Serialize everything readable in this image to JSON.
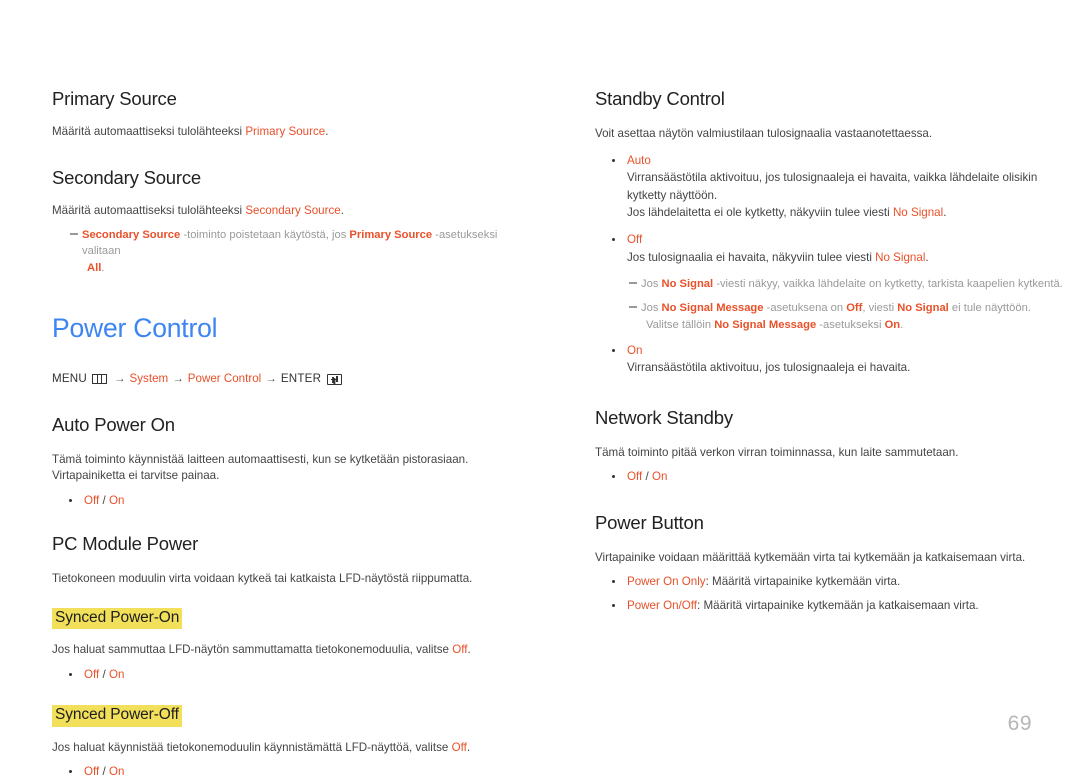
{
  "page": {
    "number": "69",
    "accent_orange": "#e8512a",
    "accent_blue": "#3d85f2",
    "highlight_yellow": "#f2e05a",
    "body_gray": "#444444",
    "note_gray": "#9a9a9a"
  },
  "left": {
    "primary_source": {
      "heading": "Primary Source",
      "body_pre": "Määritä automaattiseksi tulolähteeksi ",
      "body_key": "Primary Source",
      "body_post": "."
    },
    "secondary_source": {
      "heading": "Secondary Source",
      "body_pre": "Määritä automaattiseksi tulolähteeksi ",
      "body_key": "Secondary Source",
      "body_post": ".",
      "note": {
        "key1": "Secondary Source",
        "mid1": " -toiminto poistetaan käytöstä, jos ",
        "key2": "Primary Source",
        "mid2": " -asetukseksi valitaan",
        "key3": "All",
        "end": "."
      }
    },
    "chapter": {
      "title": "Power Control",
      "menu_label": "MENU",
      "menu_icon": "menu-grid-icon",
      "path1": "System",
      "path2": "Power Control",
      "enter_label": "ENTER",
      "enter_icon": "enter-key-icon",
      "arrow": "→"
    },
    "auto_power_on": {
      "heading": "Auto Power On",
      "body_line1": "Tämä toiminto käynnistää laitteen automaattisesti, kun se kytketään pistorasiaan.",
      "body_line2": "Virtapainiketta ei tarvitse painaa.",
      "option_off": "Off",
      "option_sep": " / ",
      "option_on": "On"
    },
    "pc_module_power": {
      "heading": "PC Module Power",
      "body": "Tietokoneen moduulin virta voidaan kytkeä tai katkaista LFD-näytöstä riippumatta.",
      "synced_on": {
        "heading": "Synced Power-On",
        "body_pre": "Jos haluat sammuttaa LFD-näytön sammuttamatta tietokonemoduulia, valitse ",
        "body_key": "Off",
        "body_post": ".",
        "option_off": "Off",
        "option_sep": " / ",
        "option_on": "On"
      },
      "synced_off": {
        "heading": "Synced Power-Off",
        "body_pre": "Jos haluat käynnistää tietokonemoduulin käynnistämättä LFD-näyttöä, valitse ",
        "body_key": "Off",
        "body_post": ".",
        "option_off": "Off",
        "option_sep": " / ",
        "option_on": "On"
      }
    }
  },
  "right": {
    "standby_control": {
      "heading": "Standby Control",
      "body": "Voit asettaa näytön valmiustilaan tulosignaalia vastaanotettaessa.",
      "auto": {
        "label": "Auto",
        "line1": "Virransäästötila aktivoituu, jos tulosignaaleja ei havaita, vaikka lähdelaite olisikin",
        "line1b": "kytketty näyttöön.",
        "line2_pre": "Jos lähdelaitetta ei ole kytketty, näkyviin tulee viesti ",
        "line2_key": "No Signal",
        "line2_post": "."
      },
      "off": {
        "label": "Off",
        "line_pre": "Jos tulosignaalia ei havaita, näkyviin tulee viesti ",
        "line_key": "No Signal",
        "line_post": "."
      },
      "note1": {
        "pre": "Jos ",
        "key1": "No Signal",
        "mid": " -viesti näkyy, vaikka lähdelaite on kytketty, tarkista kaapelien kytkentä."
      },
      "note2": {
        "pre": "Jos ",
        "key1": "No Signal Message",
        "mid1": " -asetuksena on ",
        "key2": "Off",
        "mid2": ", viesti ",
        "key3": "No Signal",
        "mid3": " ei tule näyttöön.",
        "cont_pre": "Valitse tällöin ",
        "cont_key1": "No Signal Message",
        "cont_mid": " -asetukseksi ",
        "cont_key2": "On",
        "cont_end": "."
      },
      "on": {
        "label": "On",
        "line": "Virransäästötila aktivoituu, jos tulosignaaleja ei havaita."
      }
    },
    "network_standby": {
      "heading": "Network Standby",
      "body": "Tämä toiminto pitää verkon virran toiminnassa, kun laite sammutetaan.",
      "option_off": "Off",
      "option_sep": " / ",
      "option_on": "On"
    },
    "power_button": {
      "heading": "Power Button",
      "body": "Virtapainike voidaan määrittää kytkemään virta tai kytkemään ja katkaisemaan virta.",
      "items": [
        {
          "key": "Power On Only",
          "text": ": Määritä virtapainike kytkemään virta."
        },
        {
          "key": "Power On/Off",
          "text": ": Määritä virtapainike kytkemään ja katkaisemaan virta."
        }
      ]
    }
  }
}
